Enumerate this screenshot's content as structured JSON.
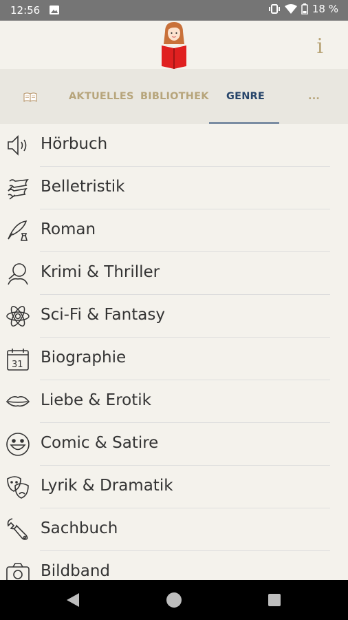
{
  "status": {
    "time": "12:56",
    "battery": "18 %"
  },
  "header": {
    "info_label": "i"
  },
  "tabs": [
    {
      "label": "AKTUELLES"
    },
    {
      "label": "BIBLIOTHEK"
    },
    {
      "label": "GENRE",
      "active": true
    },
    {
      "label": "..."
    }
  ],
  "genres": [
    {
      "label": "Hörbuch",
      "icon": "speaker-icon"
    },
    {
      "label": "Belletristik",
      "icon": "scroll-icon"
    },
    {
      "label": "Roman",
      "icon": "quill-icon"
    },
    {
      "label": "Krimi & Thriller",
      "icon": "detective-icon"
    },
    {
      "label": "Sci-Fi & Fantasy",
      "icon": "atom-icon"
    },
    {
      "label": "Biographie",
      "icon": "calendar-icon"
    },
    {
      "label": "Liebe & Erotik",
      "icon": "lips-icon"
    },
    {
      "label": "Comic & Satire",
      "icon": "smiley-icon"
    },
    {
      "label": "Lyrik & Dramatik",
      "icon": "theater-icon"
    },
    {
      "label": "Sachbuch",
      "icon": "wrench-icon"
    },
    {
      "label": "Bildband",
      "icon": "camera-icon"
    }
  ],
  "colors": {
    "accent": "#27456a",
    "tab_inactive": "#b7a57b",
    "background": "#f4f2ec"
  }
}
